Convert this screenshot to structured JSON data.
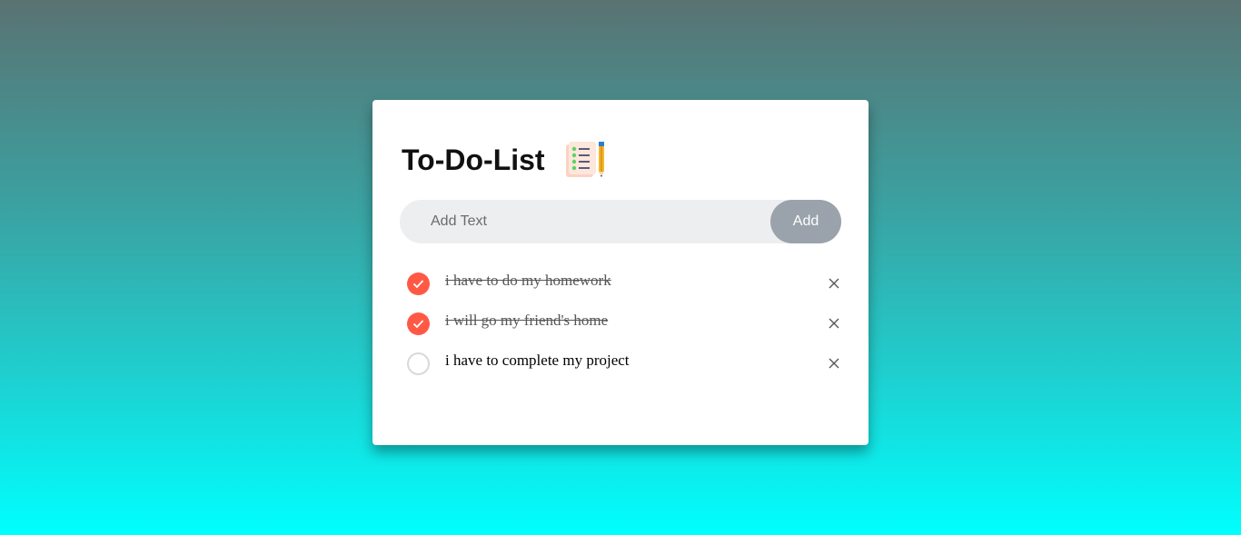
{
  "app": {
    "title": "To-Do-List"
  },
  "input": {
    "placeholder": "Add Text",
    "value": ""
  },
  "add_button": {
    "label": "Add"
  },
  "tasks": [
    {
      "text": "i have to do my homework",
      "checked": true
    },
    {
      "text": "i will go my friend's home",
      "checked": true
    },
    {
      "text": "i have to complete my project",
      "checked": false
    }
  ],
  "colors": {
    "accent": "#ff5945",
    "button": "#9aa3ab",
    "input_bg": "#edeef0"
  },
  "icons": {
    "logo": "todo-list-notepad-pencil-icon",
    "check": "checkmark-icon",
    "remove": "close-icon"
  }
}
